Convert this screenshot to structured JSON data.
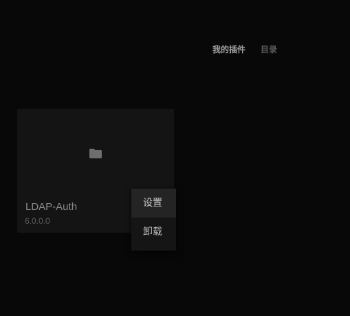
{
  "tabs": [
    {
      "label": "我的插件",
      "active": true
    },
    {
      "label": "目录",
      "active": false
    }
  ],
  "plugin_card": {
    "name": "LDAP-Auth",
    "version": "6.0.0.0",
    "icon": "folder-icon"
  },
  "context_menu": {
    "items": [
      {
        "label": "设置"
      },
      {
        "label": "卸载"
      }
    ]
  },
  "colors": {
    "background": "#080808",
    "card": "#141414",
    "menu": "#151515",
    "menu_hover": "#242424",
    "icon": "#6e6e6e"
  }
}
